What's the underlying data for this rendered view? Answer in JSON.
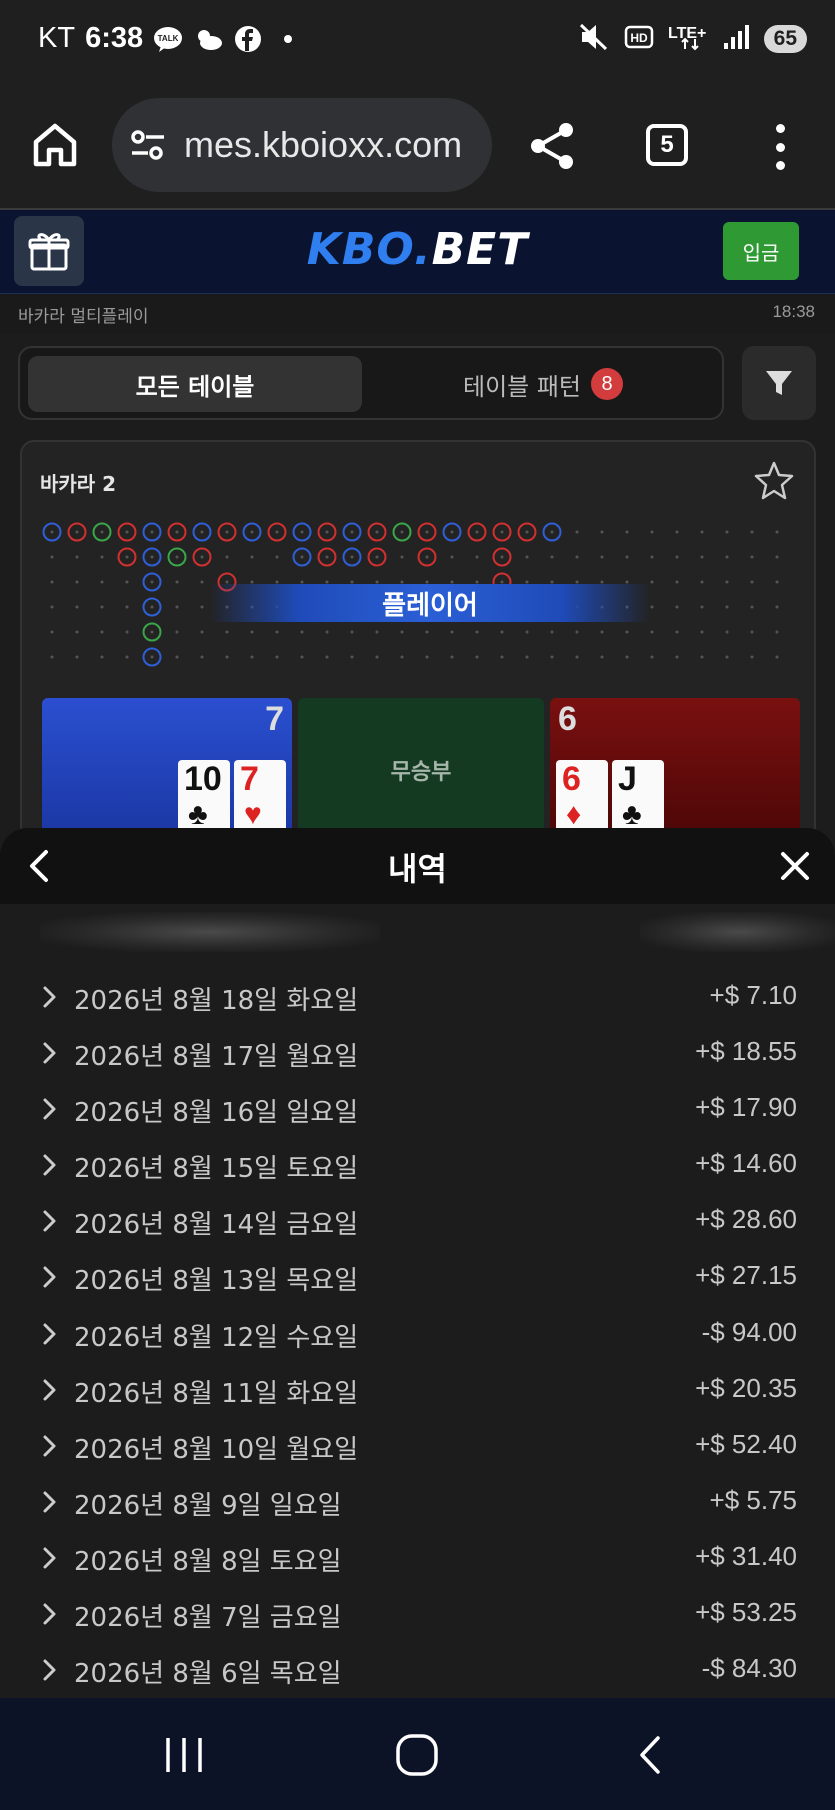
{
  "status_bar": {
    "carrier": "KT",
    "time": "6:38",
    "notification_icons": [
      "talk-icon",
      "weather-icon",
      "facebook-icon",
      "dot-icon"
    ],
    "system_icons": [
      "mute-icon",
      "hd-icon",
      "lte-icon",
      "signal-icon"
    ],
    "battery": "65"
  },
  "browser": {
    "url": "mes.kboioxx.com",
    "tab_count": "5"
  },
  "site_header": {
    "logo_left": "KBO.",
    "logo_right": "BET",
    "deposit_label": "입금"
  },
  "subheader": {
    "title": "바카라 멀티플레이",
    "time": "18:38"
  },
  "filter_tabs": {
    "all_tables": "모든 테이블",
    "table_pattern": "테이블 패턴",
    "pattern_badge": "8"
  },
  "table": {
    "name": "바카라 2",
    "banner": "플레이어",
    "player_score": "7",
    "tie_label": "무승부",
    "banker_score": "6",
    "player_cards": [
      {
        "rank": "10",
        "suit": "♣",
        "color": "black"
      },
      {
        "rank": "7",
        "suit": "♥",
        "color": "red"
      }
    ],
    "banker_cards": [
      {
        "rank": "6",
        "suit": "♦",
        "color": "red"
      },
      {
        "rank": "J",
        "suit": "♣",
        "color": "black"
      }
    ],
    "colors": {
      "player": "#2f5fd8",
      "banker": "#d23030",
      "tie": "#3aa64a"
    }
  },
  "history": {
    "title": "내역",
    "rows": [
      {
        "date": "2026년 8월 18일 화요일",
        "amount": "+$ 7.10"
      },
      {
        "date": "2026년 8월 17일 월요일",
        "amount": "+$ 18.55"
      },
      {
        "date": "2026년 8월 16일 일요일",
        "amount": "+$ 17.90"
      },
      {
        "date": "2026년 8월 15일 토요일",
        "amount": "+$ 14.60"
      },
      {
        "date": "2026년 8월 14일 금요일",
        "amount": "+$ 28.60"
      },
      {
        "date": "2026년 8월 13일 목요일",
        "amount": "+$ 27.15"
      },
      {
        "date": "2026년 8월 12일 수요일",
        "amount": "-$ 94.00"
      },
      {
        "date": "2026년 8월 11일 화요일",
        "amount": "+$ 20.35"
      },
      {
        "date": "2026년 8월 10일 월요일",
        "amount": "+$ 52.40"
      },
      {
        "date": "2026년 8월 9일 일요일",
        "amount": "+$ 5.75"
      },
      {
        "date": "2026년 8월 8일 토요일",
        "amount": "+$ 31.40"
      },
      {
        "date": "2026년 8월 7일 금요일",
        "amount": "+$ 53.25"
      },
      {
        "date": "2026년 8월 6일 목요일",
        "amount": "-$ 84.30"
      }
    ]
  },
  "nav_bar": {
    "icons": [
      "recent-apps-icon",
      "home-icon",
      "back-icon"
    ]
  }
}
